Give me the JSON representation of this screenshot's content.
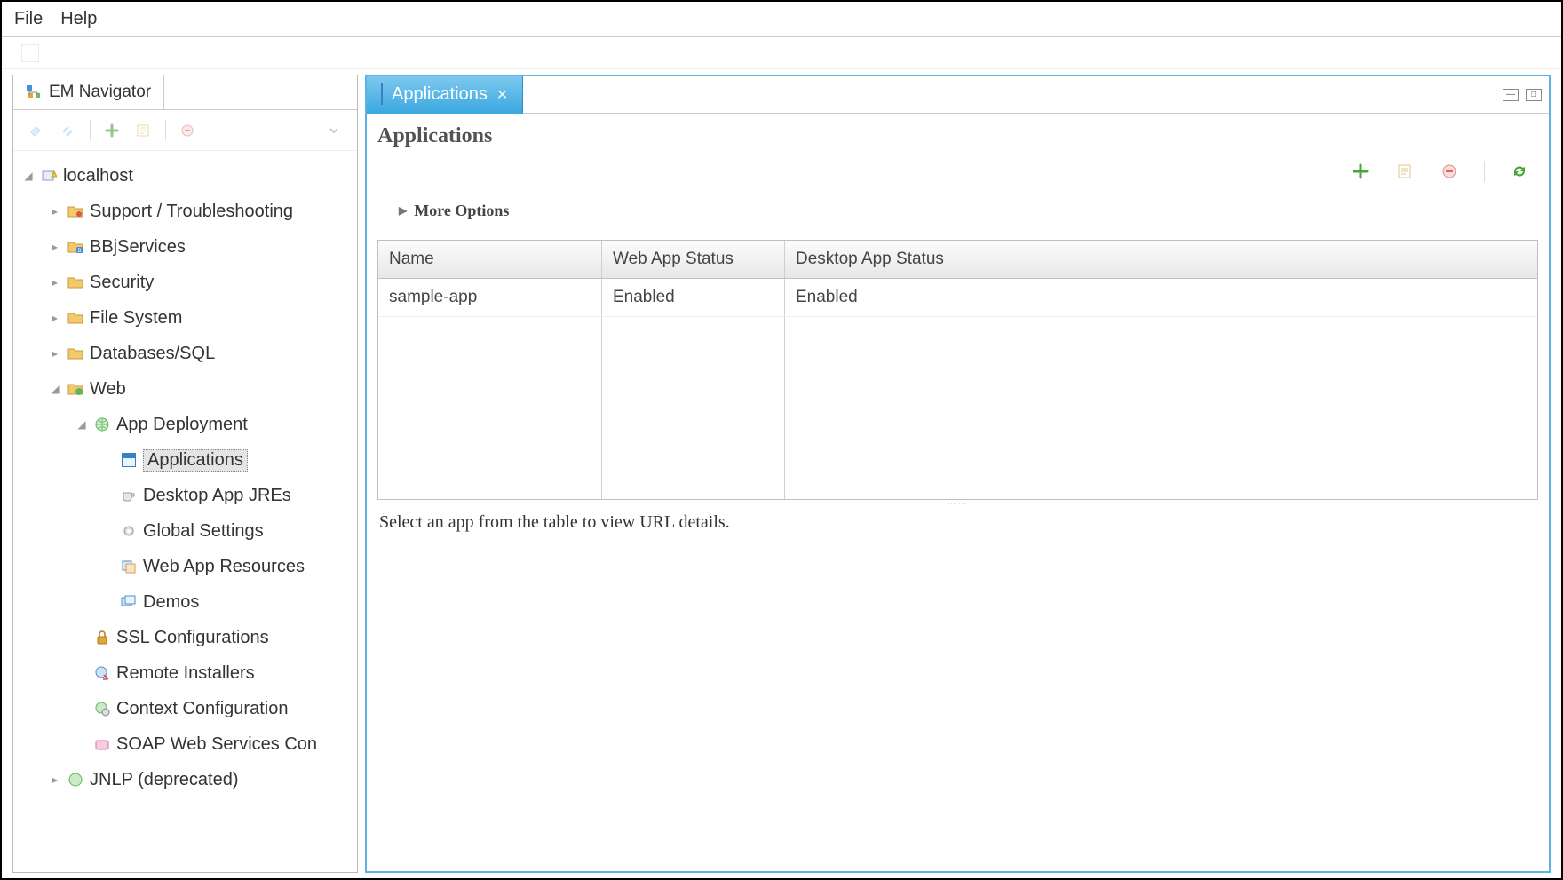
{
  "menubar": {
    "file": "File",
    "help": "Help"
  },
  "nav": {
    "title": "EM Navigator",
    "tree": {
      "root": "localhost",
      "support": "Support / Troubleshooting",
      "bbj": "BBjServices",
      "security": "Security",
      "fs": "File System",
      "db": "Databases/SQL",
      "web": "Web",
      "appdep": "App Deployment",
      "apps": "Applications",
      "jres": "Desktop App JREs",
      "glob": "Global Settings",
      "webres": "Web App Resources",
      "demos": "Demos",
      "ssl": "SSL Configurations",
      "remote": "Remote Installers",
      "ctx": "Context Configuration",
      "soap": "SOAP Web Services Con",
      "jnlp": "JNLP (deprecated)"
    }
  },
  "tab": {
    "label": "Applications"
  },
  "page": {
    "title": "Applications",
    "more": "More Options",
    "columns": {
      "name": "Name",
      "web": "Web App Status",
      "desk": "Desktop App Status"
    },
    "rows": [
      {
        "name": "sample-app",
        "web": "Enabled",
        "desk": "Enabled"
      }
    ],
    "footer": "Select an app from the table to view URL details."
  }
}
